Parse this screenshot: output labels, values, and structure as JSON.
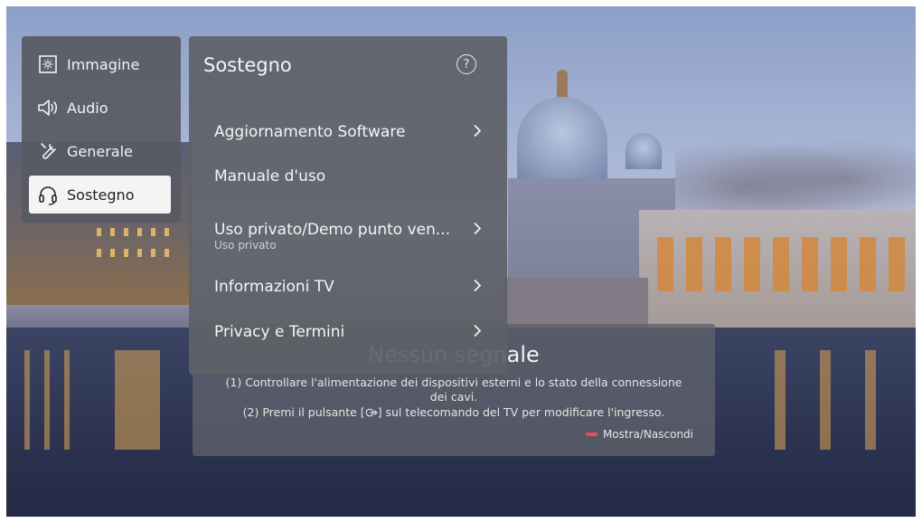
{
  "sidebar": {
    "items": [
      {
        "label": "Immagine",
        "icon": "picture-settings-icon"
      },
      {
        "label": "Audio",
        "icon": "speaker-icon"
      },
      {
        "label": "Generale",
        "icon": "wrench-icon"
      },
      {
        "label": "Sostegno",
        "icon": "headset-icon",
        "active": true
      }
    ]
  },
  "panel": {
    "title": "Sostegno",
    "help_icon": "help-icon",
    "items": [
      {
        "label": "Aggiornamento Software",
        "sub": "",
        "has_arrow": true
      },
      {
        "label": "Manuale d'uso",
        "sub": "",
        "has_arrow": false
      },
      {
        "label": "Uso privato/Demo punto ven...",
        "sub": "Uso privato",
        "has_arrow": true
      },
      {
        "label": "Informazioni TV",
        "sub": "",
        "has_arrow": true
      },
      {
        "label": "Privacy e Termini",
        "sub": "",
        "has_arrow": true
      }
    ]
  },
  "no_signal": {
    "title": "Nessun segnale",
    "line1": "(1) Controllare l'alimentazione dei dispositivi esterni e lo stato della connessione",
    "line1b": "dei cavi.",
    "line2_pre": "(2) Premi il pulsante [",
    "line2_post": "] sul telecomando del TV per modificare l'ingresso.",
    "input_icon": "input-source-icon",
    "legend": "Mostra/Nascondi",
    "legend_color": "#e84a5f"
  }
}
